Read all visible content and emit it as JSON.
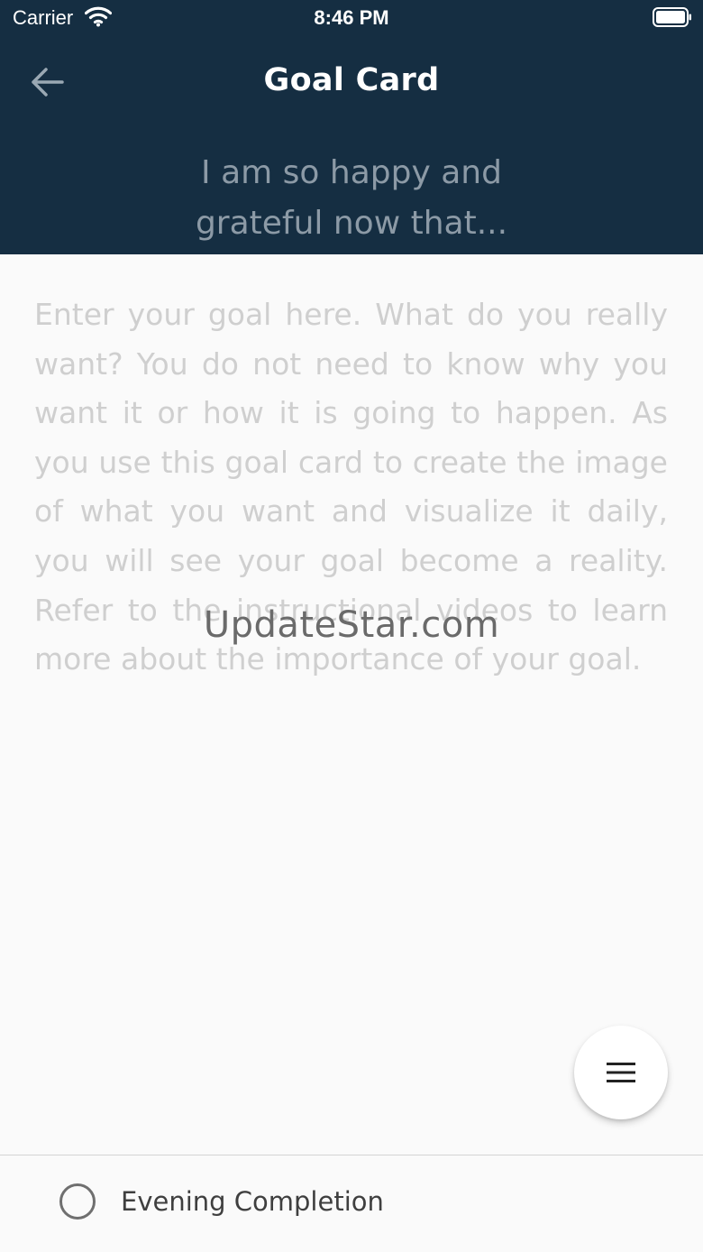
{
  "status_bar": {
    "carrier": "Carrier",
    "time": "8:46 PM",
    "wifi_icon": "wifi-icon",
    "battery_icon": "battery-icon"
  },
  "nav": {
    "back_icon": "arrow-left-icon",
    "title": "Goal Card"
  },
  "header": {
    "prompt_line1": "I am so happy and",
    "prompt_line2": "grateful now that..."
  },
  "goal_input": {
    "value": "",
    "placeholder": "Enter your goal here. What do you really want? You do not need to know why you want it or how it is going to happen. As you use this goal card to create the image of what you want and visualize it daily, you will see your goal become a reality. Refer to the instructional videos to learn more about the importance of your goal."
  },
  "watermark": "UpdateStar.com",
  "fab": {
    "icon": "menu-icon"
  },
  "bottom": {
    "completion_label": "Evening Completion",
    "completion_checked": false
  },
  "colors": {
    "header_bg": "#152e42",
    "page_bg": "#fafafa",
    "prompt_text": "#8c9aa6",
    "placeholder_text": "#cfcfcf"
  }
}
